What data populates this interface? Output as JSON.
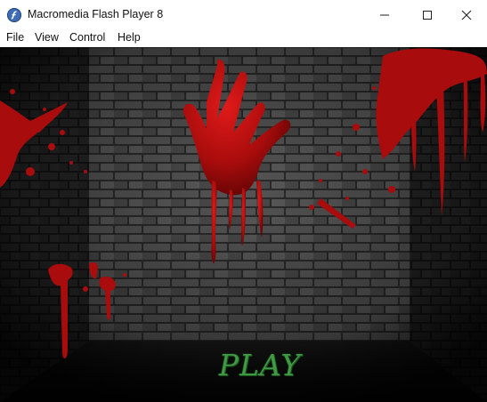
{
  "window": {
    "title": "Macromedia Flash Player 8",
    "icon": "flash-player-icon",
    "controls": [
      "minimize-icon",
      "maximize-icon",
      "close-icon"
    ]
  },
  "menu": {
    "items": [
      {
        "label": "File"
      },
      {
        "label": "View"
      },
      {
        "label": "Control"
      },
      {
        "label": "Help"
      }
    ]
  },
  "game": {
    "play_label": "PLAY",
    "play_color": "#3f9a43",
    "blood_color": "#b00d0d",
    "wall_color": "#3a3a3a"
  }
}
